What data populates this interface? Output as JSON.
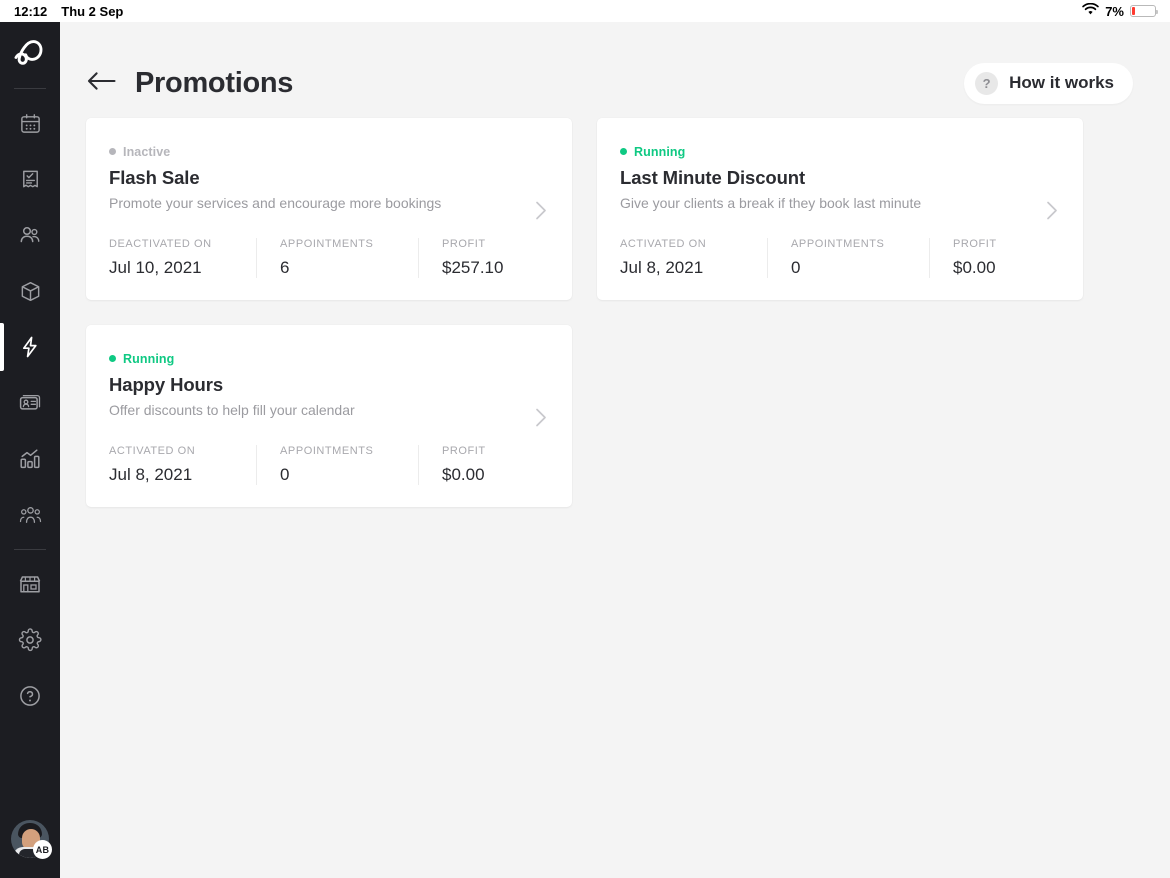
{
  "statusbar": {
    "time": "12:12",
    "date": "Thu 2 Sep",
    "battery_percent": "7%",
    "wifi_icon": "wifi-icon",
    "battery_icon": "battery-low-icon"
  },
  "sidebar": {
    "logo": {
      "name": "booksy-logo",
      "alt": "b"
    },
    "items": [
      {
        "id": "calendar",
        "icon": "calendar-icon",
        "active": false
      },
      {
        "id": "checkout",
        "icon": "receipt-check-icon",
        "active": false
      },
      {
        "id": "clients",
        "icon": "clients-icon",
        "active": false
      },
      {
        "id": "inventory",
        "icon": "package-icon",
        "active": false
      },
      {
        "id": "promotions",
        "icon": "lightning-bolt-icon",
        "active": true
      },
      {
        "id": "marketing",
        "icon": "id-card-icon",
        "active": false
      },
      {
        "id": "statistics",
        "icon": "bar-chart-icon",
        "active": false
      },
      {
        "id": "staff",
        "icon": "staff-group-icon",
        "active": false
      },
      {
        "id": "business",
        "icon": "storefront-icon",
        "active": false
      },
      {
        "id": "settings",
        "icon": "gear-icon",
        "active": false
      },
      {
        "id": "help",
        "icon": "question-circle-icon",
        "active": false
      }
    ],
    "avatar": {
      "initials": "AB",
      "name": "user-avatar"
    }
  },
  "header": {
    "back_icon": "back-arrow-icon",
    "title": "Promotions",
    "how_it_works": {
      "label": "How it works",
      "icon_glyph": "?",
      "icon_name": "question-mark-icon"
    }
  },
  "colors": {
    "running_green": "#0FC983",
    "inactive_gray": "#B6B6BB",
    "page_bg": "#F4F4F4",
    "card_bg": "#FFFFFF",
    "sidebar_bg": "#1C1D22",
    "text_dark": "#2B2C31",
    "text_muted": "#9B9BA0",
    "battery_red": "#FF3B30"
  },
  "promotions": [
    {
      "status": "Inactive",
      "status_state": "inactive",
      "title": "Flash Sale",
      "description": "Promote your services and encourage more bookings",
      "stats": [
        {
          "label": "DEACTIVATED ON",
          "value": "Jul 10, 2021"
        },
        {
          "label": "APPOINTMENTS",
          "value": "6"
        },
        {
          "label": "PROFIT",
          "value": "$257.10"
        }
      ]
    },
    {
      "status": "Running",
      "status_state": "running",
      "title": "Last Minute Discount",
      "description": "Give your clients a break if they book last minute",
      "stats": [
        {
          "label": "ACTIVATED ON",
          "value": "Jul 8, 2021"
        },
        {
          "label": "APPOINTMENTS",
          "value": "0"
        },
        {
          "label": "PROFIT",
          "value": "$0.00"
        }
      ]
    },
    {
      "status": "Running",
      "status_state": "running",
      "title": "Happy Hours",
      "description": "Offer discounts to help fill your calendar",
      "stats": [
        {
          "label": "ACTIVATED ON",
          "value": "Jul 8, 2021"
        },
        {
          "label": "APPOINTMENTS",
          "value": "0"
        },
        {
          "label": "PROFIT",
          "value": "$0.00"
        }
      ]
    }
  ]
}
